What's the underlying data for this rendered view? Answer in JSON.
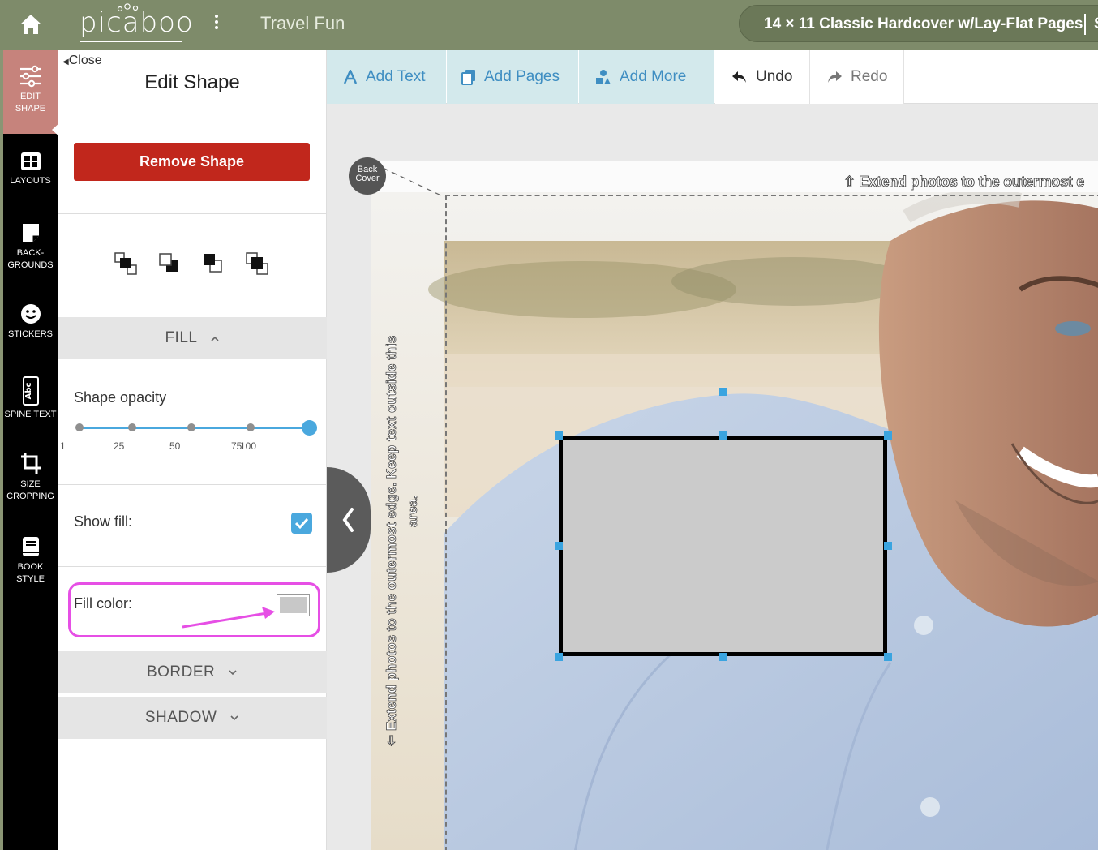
{
  "topbar": {
    "logo": "picaboo",
    "project_title": "Travel Fun",
    "product": "14 × 11 Classic Hardcover w/Lay-Flat Pages",
    "product_tail": "S"
  },
  "rail": {
    "items": [
      {
        "label": "EDIT SHAPE",
        "icon": "sliders-icon",
        "active": true
      },
      {
        "label": "LAYOUTS",
        "icon": "layout-grid-icon"
      },
      {
        "label": "BACK-GROUNDS",
        "icon": "background-icon"
      },
      {
        "label": "STICKERS",
        "icon": "smiley-icon"
      },
      {
        "label": "SPINE TEXT",
        "icon": "spine-text-icon"
      },
      {
        "label": "SIZE CROPPING",
        "icon": "crop-icon"
      },
      {
        "label": "BOOK STYLE",
        "icon": "book-icon"
      }
    ]
  },
  "panel": {
    "close_label": "Close",
    "title": "Edit Shape",
    "remove_label": "Remove Shape",
    "arrange_icons": [
      "bring-to-front-icon",
      "send-backward-icon",
      "bring-forward-icon",
      "send-to-back-icon"
    ],
    "fill": {
      "header": "FILL",
      "opacity_label": "Shape opacity",
      "opacity_value": 100,
      "ticks": [
        "1",
        "25",
        "50",
        "75",
        "100"
      ],
      "show_fill_label": "Show fill:",
      "show_fill_checked": true,
      "fill_color_label": "Fill color:",
      "fill_color": "#c8c8c8"
    },
    "border_header": "BORDER",
    "shadow_header": "SHADOW"
  },
  "toolbar": {
    "add_text": "Add Text",
    "add_pages": "Add Pages",
    "add_more": "Add More",
    "undo": "Undo",
    "redo": "Redo"
  },
  "canvas": {
    "back_cover": "Back Cover",
    "extend_top": "Extend photos to the outermost e",
    "side_note_1": "Extend photos to the outermost edge. Keep text outside this",
    "side_note_2": "area.",
    "shape_fill": "#cbcbcb"
  },
  "colors": {
    "topbar": "#7e8b6a",
    "accent": "#4aa8de",
    "remove": "#c1271c",
    "highlight": "#e64fe5"
  }
}
